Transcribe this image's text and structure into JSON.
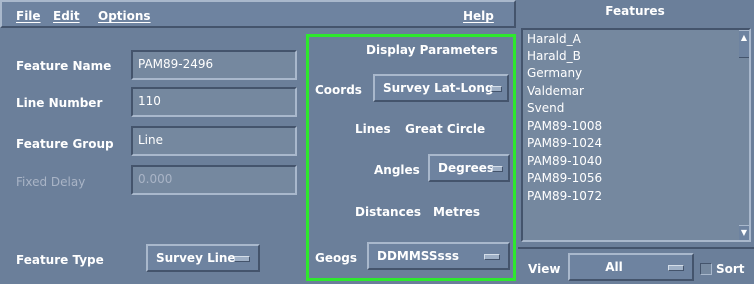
{
  "menu": {
    "file": "File",
    "edit": "Edit",
    "options": "Options",
    "help": "Help"
  },
  "form": {
    "feature_name": {
      "label": "Feature Name",
      "value": "PAM89-2496"
    },
    "line_number": {
      "label": "Line Number",
      "value": "110"
    },
    "feature_group": {
      "label": "Feature Group",
      "value": "Line"
    },
    "fixed_delay": {
      "label": "Fixed Delay",
      "value": "0.000"
    },
    "feature_type": {
      "label": "Feature Type",
      "value": "Survey Line"
    }
  },
  "display_parameters": {
    "title": "Display Parameters",
    "coords_label": "Coords",
    "coords_value": "Survey Lat-Long",
    "lines_label": "Lines",
    "lines_value": "Great Circle",
    "angles_label": "Angles",
    "angles_value": "Degrees",
    "distances_label": "Distances",
    "distances_value": "Metres",
    "geogs_label": "Geogs",
    "geogs_value": "DDMMSSsss",
    "highlight_color": "#2ee82e"
  },
  "features": {
    "title": "Features",
    "items": [
      "Harald_A",
      "Harald_B",
      "Germany",
      "Valdemar",
      "Svend",
      "PAM89-1008",
      "PAM89-1024",
      "PAM89-1040",
      "PAM89-1056",
      "PAM89-1072"
    ],
    "view_label": "View",
    "view_value": "All",
    "sort_label": "Sort"
  },
  "colors": {
    "background": "#6b7f9a",
    "field": "#75889f"
  }
}
